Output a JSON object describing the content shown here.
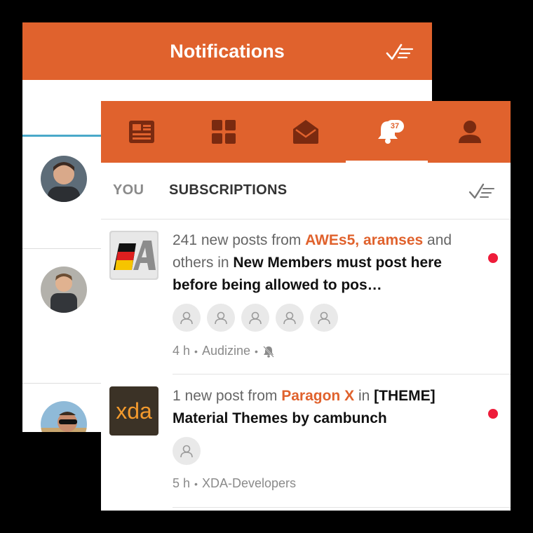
{
  "back_screen": {
    "title": "Notifications",
    "icons": {
      "mark_all": "mark-all-read-icon"
    }
  },
  "front_screen": {
    "nav": {
      "items": [
        {
          "name": "feed",
          "icon": "newspaper-icon"
        },
        {
          "name": "forums",
          "icon": "grid-icon"
        },
        {
          "name": "messages",
          "icon": "envelope-icon"
        },
        {
          "name": "notifications",
          "icon": "bell-icon",
          "badge": "37",
          "active": true
        },
        {
          "name": "profile",
          "icon": "person-icon"
        }
      ]
    },
    "tabs": {
      "you": "YOU",
      "subscriptions": "SUBSCRIPTIONS",
      "mark_all_icon": "mark-all-read-icon"
    },
    "notifications": [
      {
        "prefix": "241 new posts from ",
        "users": "AWEs5, aramses",
        "middle": " and others in ",
        "thread": "New Members must post here before being allowed to pos…",
        "participant_count": 5,
        "time": "4 h",
        "source": "Audizine",
        "muted_icon": "bell-off-icon",
        "unread": true
      },
      {
        "prefix": "1 new post from ",
        "users": "Paragon X",
        "middle": " in ",
        "thread": "[THEME] Material Themes by cambunch",
        "participant_count": 1,
        "time": "5 h",
        "source": "XDA-Developers",
        "unread": true
      }
    ],
    "colors": {
      "brand": "#e0622d",
      "unread_dot": "#ee1c3a",
      "meta": "#8a8a8a"
    }
  }
}
